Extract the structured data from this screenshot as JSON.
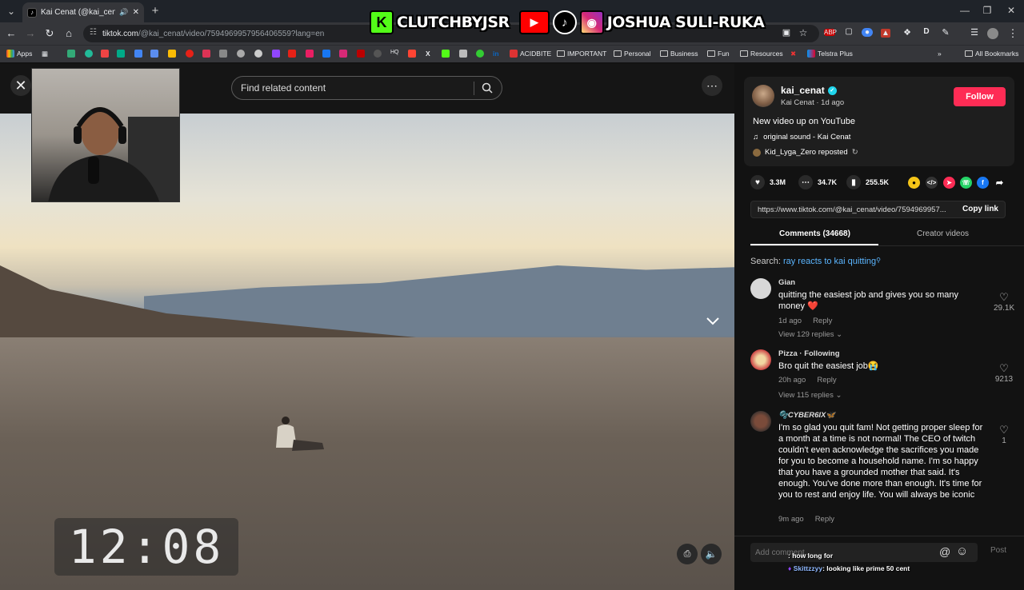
{
  "browser": {
    "tab_title": "Kai Cenat (@kai_cenat) Offi...",
    "url_domain": "tiktok.com",
    "url_path": "/@kai_cenat/video/7594969957956406559?lang=en",
    "bookmarks": [
      "Apps",
      "ACIDBITE",
      "IMPORTANT",
      "Personal",
      "Business",
      "Fun",
      "Resources",
      "Telstra Plus"
    ],
    "all_bookmarks": "All Bookmarks"
  },
  "overlay": {
    "handle1": "CLUTCHBYJSR",
    "handle2": "JOSHUA SULI-RUKA"
  },
  "video": {
    "search_placeholder": "Find related content",
    "timer": "12:08"
  },
  "creator": {
    "username": "kai_cenat",
    "display_name": "Kai Cenat",
    "time_ago": "1d ago",
    "subline": "Kai Cenat · 1d ago",
    "follow_label": "Follow",
    "description": "New video up on YouTube",
    "sound": "original sound - Kai Cenat",
    "reposted": "Kid_Lyga_Zero reposted"
  },
  "stats": {
    "likes": "3.3M",
    "comments": "34.7K",
    "saves": "255.5K"
  },
  "share": {
    "link": "https://www.tiktok.com/@kai_cenat/video/7594969957...",
    "copy_label": "Copy link"
  },
  "tabs": {
    "comments": "Comments (34668)",
    "creator_videos": "Creator videos"
  },
  "search_suggestion": {
    "prefix": "Search: ",
    "query": "ray reacts to kai quitting"
  },
  "comments": [
    {
      "name": "Gian",
      "text": "quitting the easiest job and gives you so many money ❤️",
      "time": "1d ago",
      "reply": "Reply",
      "replies": "View 129 replies",
      "likes": "29.1K"
    },
    {
      "name": "Pizza · Following",
      "text": "Bro quit the easiest job😭",
      "time": "20h ago",
      "reply": "Reply",
      "replies": "View 115 replies",
      "likes": "9213"
    },
    {
      "name": "🫧CYBER6IX🦋",
      "text": "I'm so glad you quit fam! Not getting proper sleep for a month at a time is not normal! The CEO of twitch couldn't even acknowledge the sacrifices you made for you to become a household name. I'm so happy that you have a grounded mother that said. It's enough. You've done more than enough. It's time for you to rest and enjoy life. You will always be iconic",
      "time": "9m ago",
      "reply": "Reply",
      "likes": "1"
    }
  ],
  "add_comment": {
    "placeholder": "Add comment...",
    "post_label": "Post"
  },
  "chat": [
    {
      "user": "",
      "message": ": how long for"
    },
    {
      "user": "Skittzzyy",
      "message": ": looking like prime 50 cent"
    }
  ],
  "colors": {
    "accent": "#fe2c55",
    "verified": "#20d5ec",
    "link": "#5bb5ff"
  }
}
